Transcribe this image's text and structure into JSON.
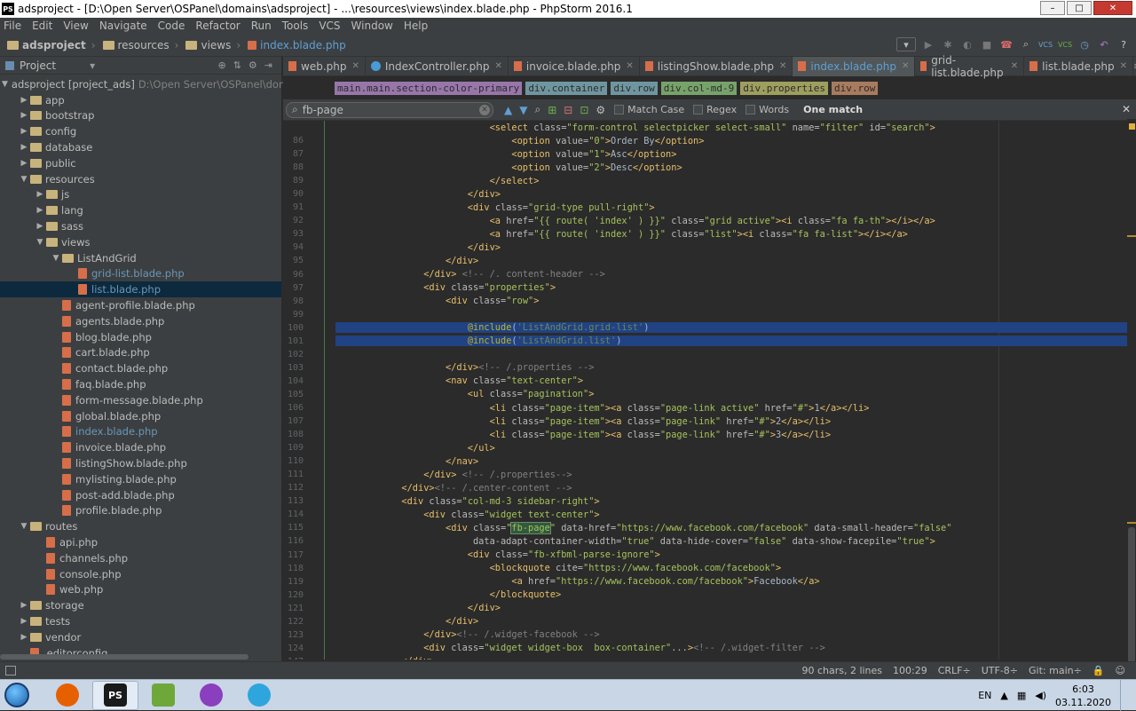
{
  "window": {
    "title": "adsproject - [D:\\Open Server\\OSPanel\\domains\\adsproject] - ...\\resources\\views\\index.blade.php - PhpStorm 2016.1",
    "logo": "PS",
    "controls": [
      "–",
      "□",
      "✕"
    ]
  },
  "menu": [
    "File",
    "Edit",
    "View",
    "Navigate",
    "Code",
    "Refactor",
    "Run",
    "Tools",
    "VCS",
    "Window",
    "Help"
  ],
  "nav_breadcrumbs": [
    "adsproject",
    "resources",
    "views",
    "index.blade.php"
  ],
  "sidebar": {
    "title": "Project",
    "root": "adsproject [project_ads]",
    "root_path": "D:\\Open Server\\OSPanel\\domains",
    "items": [
      {
        "label": "app",
        "type": "folder",
        "depth": 1,
        "arrow": "▶"
      },
      {
        "label": "bootstrap",
        "type": "folder",
        "depth": 1,
        "arrow": "▶"
      },
      {
        "label": "config",
        "type": "folder",
        "depth": 1,
        "arrow": "▶"
      },
      {
        "label": "database",
        "type": "folder",
        "depth": 1,
        "arrow": "▶"
      },
      {
        "label": "public",
        "type": "folder",
        "depth": 1,
        "arrow": "▶"
      },
      {
        "label": "resources",
        "type": "folder",
        "depth": 1,
        "arrow": "▼"
      },
      {
        "label": "js",
        "type": "folder",
        "depth": 2,
        "arrow": "▶"
      },
      {
        "label": "lang",
        "type": "folder",
        "depth": 2,
        "arrow": "▶"
      },
      {
        "label": "sass",
        "type": "folder",
        "depth": 2,
        "arrow": "▶"
      },
      {
        "label": "views",
        "type": "folder",
        "depth": 2,
        "arrow": "▼"
      },
      {
        "label": "ListAndGrid",
        "type": "folder",
        "depth": 3,
        "arrow": "▼"
      },
      {
        "label": "grid-list.blade.php",
        "type": "file",
        "depth": 4,
        "arrow": "",
        "color": "blue"
      },
      {
        "label": "list.blade.php",
        "type": "file",
        "depth": 4,
        "arrow": "",
        "color": "blue",
        "selected": true
      },
      {
        "label": "agent-profile.blade.php",
        "type": "file",
        "depth": 3,
        "arrow": ""
      },
      {
        "label": "agents.blade.php",
        "type": "file",
        "depth": 3,
        "arrow": ""
      },
      {
        "label": "blog.blade.php",
        "type": "file",
        "depth": 3,
        "arrow": ""
      },
      {
        "label": "cart.blade.php",
        "type": "file",
        "depth": 3,
        "arrow": ""
      },
      {
        "label": "contact.blade.php",
        "type": "file",
        "depth": 3,
        "arrow": ""
      },
      {
        "label": "faq.blade.php",
        "type": "file",
        "depth": 3,
        "arrow": ""
      },
      {
        "label": "form-message.blade.php",
        "type": "file",
        "depth": 3,
        "arrow": ""
      },
      {
        "label": "global.blade.php",
        "type": "file",
        "depth": 3,
        "arrow": ""
      },
      {
        "label": "index.blade.php",
        "type": "file",
        "depth": 3,
        "arrow": "",
        "color": "blue"
      },
      {
        "label": "invoice.blade.php",
        "type": "file",
        "depth": 3,
        "arrow": ""
      },
      {
        "label": "listingShow.blade.php",
        "type": "file",
        "depth": 3,
        "arrow": ""
      },
      {
        "label": "mylisting.blade.php",
        "type": "file",
        "depth": 3,
        "arrow": ""
      },
      {
        "label": "post-add.blade.php",
        "type": "file",
        "depth": 3,
        "arrow": ""
      },
      {
        "label": "profile.blade.php",
        "type": "file",
        "depth": 3,
        "arrow": ""
      },
      {
        "label": "routes",
        "type": "folder",
        "depth": 1,
        "arrow": "▼"
      },
      {
        "label": "api.php",
        "type": "file",
        "depth": 2,
        "arrow": ""
      },
      {
        "label": "channels.php",
        "type": "file",
        "depth": 2,
        "arrow": ""
      },
      {
        "label": "console.php",
        "type": "file",
        "depth": 2,
        "arrow": ""
      },
      {
        "label": "web.php",
        "type": "file",
        "depth": 2,
        "arrow": ""
      },
      {
        "label": "storage",
        "type": "folder",
        "depth": 1,
        "arrow": "▶"
      },
      {
        "label": "tests",
        "type": "folder",
        "depth": 1,
        "arrow": "▶"
      },
      {
        "label": "vendor",
        "type": "folder",
        "depth": 1,
        "arrow": "▶"
      },
      {
        "label": ".editorconfig",
        "type": "file",
        "depth": 1,
        "arrow": ""
      }
    ]
  },
  "tabs": [
    {
      "label": "web.php",
      "kind": "php"
    },
    {
      "label": "IndexController.php",
      "kind": "class"
    },
    {
      "label": "invoice.blade.php",
      "kind": "php"
    },
    {
      "label": "listingShow.blade.php",
      "kind": "php"
    },
    {
      "label": "index.blade.php",
      "kind": "php",
      "active": true
    },
    {
      "label": "grid-list.blade.php",
      "kind": "php"
    },
    {
      "label": "list.blade.php",
      "kind": "php"
    }
  ],
  "html_breadcrumb": [
    {
      "label": "main.main.section-color-primary",
      "color": "#9876aa"
    },
    {
      "label": "div.container",
      "color": "#6f96a0"
    },
    {
      "label": "div.row",
      "color": "#6f96a0"
    },
    {
      "label": "div.col-md-9",
      "color": "#77a36a"
    },
    {
      "label": "div.properties",
      "color": "#9e9e5f"
    },
    {
      "label": "div.row",
      "color": "#a87b5f"
    }
  ],
  "find": {
    "query": "fb-page",
    "match_case": "Match Case",
    "regex": "Regex",
    "words": "Words",
    "result": "One match"
  },
  "code_lines": [
    {
      "n": "",
      "text": "                            <select class=\"form-control selectpicker select-small\" name=\"filter\" id=\"search\">"
    },
    {
      "n": "86",
      "text": "                                <option value=\"0\">Order By</option>"
    },
    {
      "n": "87",
      "text": "                                <option value=\"1\">Asc</option>"
    },
    {
      "n": "88",
      "text": "                                <option value=\"2\">Desc</option>"
    },
    {
      "n": "89",
      "text": "                            </select>"
    },
    {
      "n": "90",
      "text": "                        </div>"
    },
    {
      "n": "91",
      "text": "                        <div class=\"grid-type pull-right\">"
    },
    {
      "n": "92",
      "text": "                            <a href=\"{{ route( 'index' ) }}\" class=\"grid active\"><i class=\"fa fa-th\"></i></a>"
    },
    {
      "n": "93",
      "text": "                            <a href=\"{{ route( 'index' ) }}\" class=\"list\"><i class=\"fa fa-list\"></i></a>"
    },
    {
      "n": "94",
      "text": "                        </div>"
    },
    {
      "n": "95",
      "text": "                    </div>"
    },
    {
      "n": "96",
      "text": "                </div> <!-- /. content-header -->"
    },
    {
      "n": "97",
      "text": "                <div class=\"properties\">"
    },
    {
      "n": "98",
      "text": "                    <div class=\"row\">"
    },
    {
      "n": "99",
      "text": ""
    },
    {
      "n": "100",
      "text": "                        @include('ListAndGrid.grid-list')",
      "hl": true
    },
    {
      "n": "101",
      "text": "                        @include('ListAndGrid.list')",
      "hl": true
    },
    {
      "n": "102",
      "text": ""
    },
    {
      "n": "103",
      "text": "                    </div><!-- /.properties -->"
    },
    {
      "n": "104",
      "text": "                    <nav class=\"text-center\">"
    },
    {
      "n": "105",
      "text": "                        <ul class=\"pagination\">"
    },
    {
      "n": "106",
      "text": "                            <li class=\"page-item\"><a class=\"page-link active\" href=\"#\">1</a></li>"
    },
    {
      "n": "107",
      "text": "                            <li class=\"page-item\"><a class=\"page-link\" href=\"#\">2</a></li>"
    },
    {
      "n": "108",
      "text": "                            <li class=\"page-item\"><a class=\"page-link\" href=\"#\">3</a></li>"
    },
    {
      "n": "109",
      "text": "                        </ul>"
    },
    {
      "n": "110",
      "text": "                    </nav>"
    },
    {
      "n": "111",
      "text": "                </div> <!-- /.properties-->"
    },
    {
      "n": "112",
      "text": "            </div><!-- /.center-content -->"
    },
    {
      "n": "113",
      "text": "            <div class=\"col-md-3 sidebar-right\">"
    },
    {
      "n": "114",
      "text": "                <div class=\"widget text-center\">"
    },
    {
      "n": "115",
      "text": "                    <div class=\"fb-page\" data-href=\"https://www.facebook.com/facebook\" data-small-header=\"false\""
    },
    {
      "n": "116",
      "text": "                         data-adapt-container-width=\"true\" data-hide-cover=\"false\" data-show-facepile=\"true\">"
    },
    {
      "n": "117",
      "text": "                        <div class=\"fb-xfbml-parse-ignore\">"
    },
    {
      "n": "118",
      "text": "                            <blockquote cite=\"https://www.facebook.com/facebook\">"
    },
    {
      "n": "119",
      "text": "                                <a href=\"https://www.facebook.com/facebook\">Facebook</a>"
    },
    {
      "n": "120",
      "text": "                            </blockquote>"
    },
    {
      "n": "121",
      "text": "                        </div>"
    },
    {
      "n": "122",
      "text": "                    </div>"
    },
    {
      "n": "123",
      "text": "                </div><!-- /.widget-facebook -->"
    },
    {
      "n": "124",
      "text": "                <div class=\"widget widget-box  box-container\"...><!-- /.widget-filter -->"
    },
    {
      "n": "147",
      "text": "            </div>"
    }
  ],
  "status": {
    "selection": "90 chars, 2 lines",
    "position": "100:29",
    "line_sep": "CRLF÷",
    "encoding": "UTF-8÷",
    "git": "Git: main÷"
  },
  "taskbar": {
    "apps": [
      {
        "name": "firefox",
        "color": "#e66000",
        "label": ""
      },
      {
        "name": "phpstorm",
        "color": "#1a1a1a",
        "label": "PS",
        "active": true
      },
      {
        "name": "notepad",
        "color": "#6ea83b",
        "label": ""
      },
      {
        "name": "gitkraken",
        "color": "#8a3fbf",
        "label": ""
      },
      {
        "name": "telegram",
        "color": "#2ea6dd",
        "label": ""
      }
    ],
    "lang": "EN",
    "time": "6:03",
    "date": "03.11.2020"
  },
  "colors": {
    "accent_blue": "#5f9fd4",
    "selection": "#214283",
    "tag": "#e8bf6a",
    "attr": "#bababa",
    "string": "#a5c25c"
  }
}
